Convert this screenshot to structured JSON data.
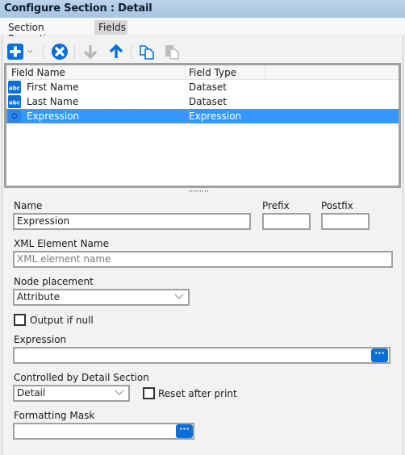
{
  "window": {
    "title": "Configure Section : Detail"
  },
  "tabs": [
    {
      "label": "Section Properties",
      "active": false
    },
    {
      "label": "Fields",
      "active": true
    }
  ],
  "toolbar": {
    "buttons": [
      {
        "name": "add",
        "icon": "plus-icon",
        "enabled": true
      },
      {
        "name": "add-dropdown",
        "icon": "chevron-down-icon",
        "enabled": true
      },
      {
        "name": "remove",
        "icon": "close-circle-icon",
        "enabled": true
      },
      {
        "name": "move-down",
        "icon": "arrow-down-icon",
        "enabled": false
      },
      {
        "name": "move-up",
        "icon": "arrow-up-icon",
        "enabled": true
      },
      {
        "name": "copy",
        "icon": "copy-icon",
        "enabled": true
      },
      {
        "name": "paste",
        "icon": "paste-icon",
        "enabled": false
      }
    ]
  },
  "fields_grid": {
    "columns": [
      "Field Name",
      "Field Type"
    ],
    "rows": [
      {
        "icon": "abc-text-icon",
        "name": "First Name",
        "type": "Dataset",
        "selected": false
      },
      {
        "icon": "abc-text-icon",
        "name": "Last Name",
        "type": "Dataset",
        "selected": false
      },
      {
        "icon": "expression-icon",
        "name": "Expression",
        "type": "Expression",
        "selected": true
      }
    ]
  },
  "splitter": {
    "glyph": "‧‧‧‧‧‧‧‧‧"
  },
  "form": {
    "name_label": "Name",
    "name_value": "Expression",
    "prefix_label": "Prefix",
    "prefix_value": "",
    "postfix_label": "Postfix",
    "postfix_value": "",
    "xml_label": "XML Element Name",
    "xml_placeholder": "XML element name",
    "node_label": "Node placement",
    "node_value": "Attribute",
    "output_null_label": "Output if null",
    "output_null_checked": false,
    "expression_label": "Expression",
    "expression_value": "",
    "ellipsis": "···",
    "controlled_label": "Controlled by Detail Section",
    "controlled_value": "Detail",
    "reset_label": "Reset after print",
    "reset_checked": false,
    "mask_label": "Formatting Mask",
    "mask_value": ""
  },
  "colors": {
    "accent": "#0a6fd8",
    "selection": "#3399ff",
    "title_bar": "#b3cce6"
  }
}
